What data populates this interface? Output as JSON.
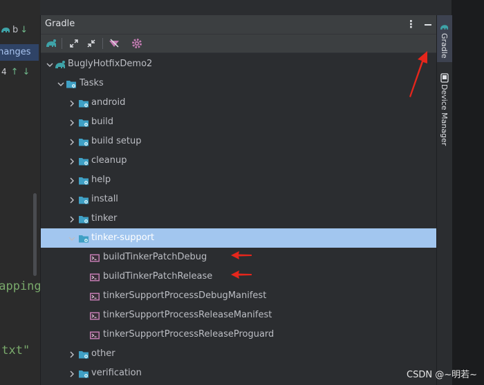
{
  "window": {
    "panel_title": "Gradle"
  },
  "left_strip": {
    "top_text": "b",
    "changes_label": "Changes",
    "nav_count": "4",
    "code_line_1": "mapping",
    "code_line_2": ".txt\""
  },
  "tree": {
    "project": "BuglyHotfixDemo2",
    "tasks": "Tasks",
    "groups": [
      "android",
      "build",
      "build setup",
      "cleanup",
      "help",
      "install",
      "tinker"
    ],
    "selected_group": "tinker-support",
    "tinker_tasks": [
      "buildTinkerPatchDebug",
      "buildTinkerPatchRelease",
      "tinkerSupportProcessDebugManifest",
      "tinkerSupportProcessReleaseManifest",
      "tinkerSupportProcessReleaseProguard"
    ],
    "after_groups": [
      "other",
      "verification"
    ]
  },
  "right_stripe": {
    "tabs": [
      "Gradle",
      "Device Manager"
    ]
  },
  "watermark": "CSDN @~明若~",
  "colors": {
    "accent": "#a2c6ef",
    "folder": "#3fa0c5",
    "task_icon": "#c27bb1",
    "elephant": "#3ea3a8",
    "arrow": "#e5261c"
  }
}
